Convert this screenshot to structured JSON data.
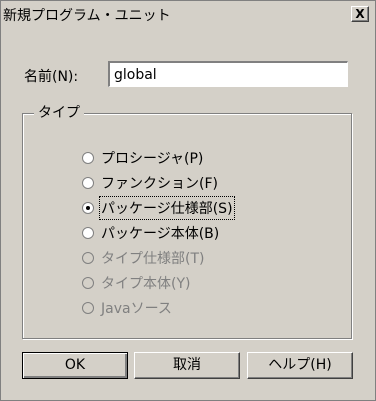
{
  "window": {
    "title": "新規プログラム・ユニット",
    "close_label": "X"
  },
  "form": {
    "name_label": "名前(N):",
    "name_value": "global"
  },
  "type_group": {
    "title": "タイプ",
    "options": [
      {
        "label": "プロシージャ(P)",
        "checked": false,
        "enabled": true
      },
      {
        "label": "ファンクション(F)",
        "checked": false,
        "enabled": true
      },
      {
        "label": "パッケージ仕様部(S)",
        "checked": true,
        "enabled": true
      },
      {
        "label": "パッケージ本体(B)",
        "checked": false,
        "enabled": true
      },
      {
        "label": "タイプ仕様部(T)",
        "checked": false,
        "enabled": false
      },
      {
        "label": "タイプ本体(Y)",
        "checked": false,
        "enabled": false
      },
      {
        "label": "Javaソース",
        "checked": false,
        "enabled": false
      }
    ]
  },
  "buttons": {
    "ok": "OK",
    "cancel": "取消",
    "help": "ヘルプ(H)"
  }
}
